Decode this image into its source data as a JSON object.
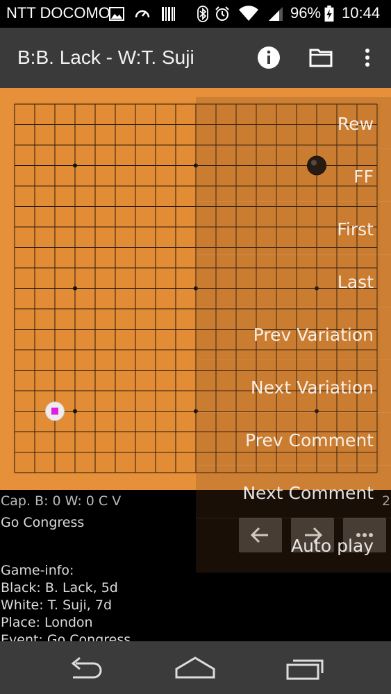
{
  "status_bar": {
    "carrier": "NTT DOCOMO",
    "battery": "96%",
    "time": "10:44",
    "icons": [
      "image-icon",
      "speedometer-icon",
      "barcode-icon",
      "bluetooth-icon",
      "alarm-icon",
      "wifi-icon",
      "signal-icon",
      "battery-charging-icon"
    ]
  },
  "app_bar": {
    "title": "B:B. Lack - W:T. Suji",
    "actions": [
      "info-icon",
      "folder-icon",
      "overflow-menu-icon"
    ]
  },
  "board": {
    "size": 19,
    "hoshi": [
      [
        3,
        3
      ],
      [
        9,
        3
      ],
      [
        15,
        3
      ],
      [
        3,
        9
      ],
      [
        9,
        9
      ],
      [
        15,
        9
      ],
      [
        3,
        15
      ],
      [
        9,
        15
      ],
      [
        15,
        15
      ]
    ],
    "stones": [
      {
        "color": "black",
        "col": 15,
        "row": 3
      },
      {
        "color": "white",
        "col": 2,
        "row": 15,
        "marker": "magenta-square"
      }
    ]
  },
  "overlay_menu": {
    "items": [
      "Rew",
      "FF",
      "First",
      "Last",
      "Prev Variation",
      "Next Variation",
      "Prev Comment",
      "Next Comment",
      "Auto play"
    ]
  },
  "info": {
    "captures": "Cap. B: 0 W: 0 C V",
    "event_line": "Go Congress",
    "game_info_header": "Game-info:",
    "black": "Black: B. Lack, 5d",
    "white": "White: T. Suji, 7d",
    "place": "Place: London",
    "event": "Event: Go Congress",
    "edge_number": "2"
  },
  "nav_buttons": [
    "arrow-left-icon",
    "arrow-right-icon",
    "more-horiz-icon"
  ],
  "system_nav": [
    "back-icon",
    "home-icon",
    "recents-icon"
  ],
  "colors": {
    "board": "#e69139",
    "app_bar": "#3a3a3a",
    "marker": "#e020e0"
  }
}
